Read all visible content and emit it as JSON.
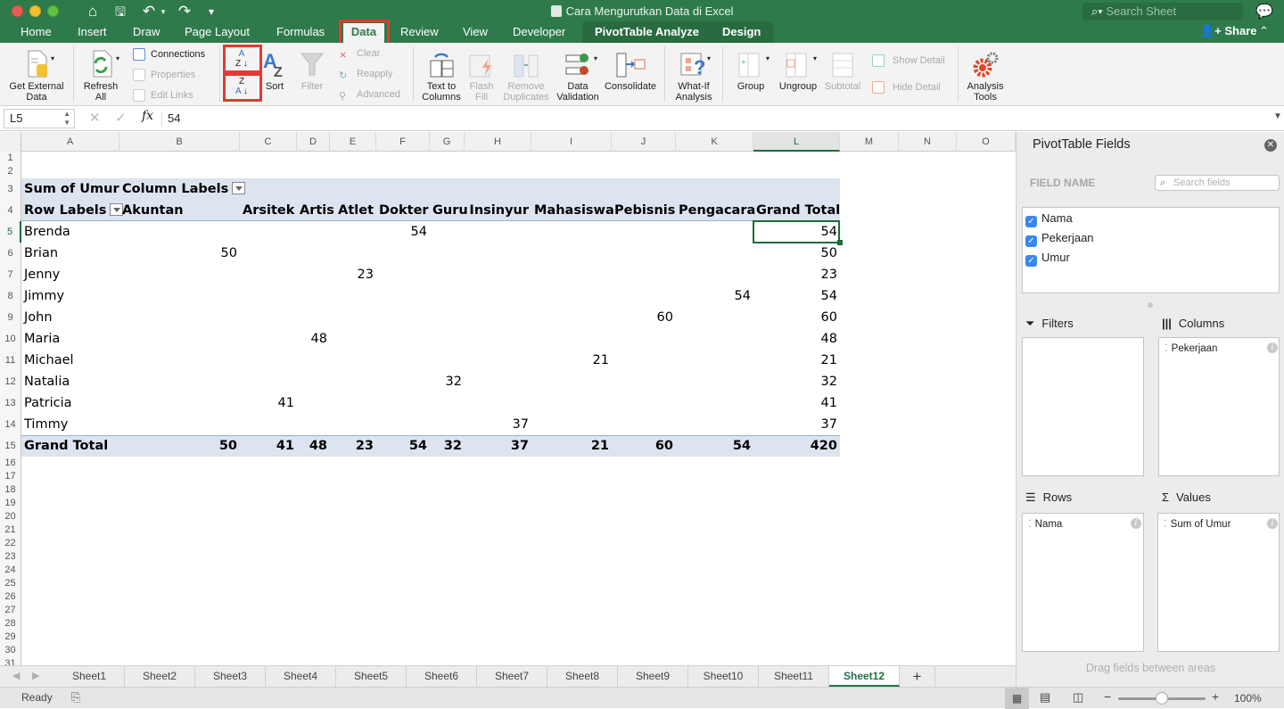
{
  "window": {
    "title": "Cara Mengurutkan Data di Excel",
    "search_placeholder": "Search Sheet",
    "share_label": "Share",
    "accent_color": "#2f7a4b"
  },
  "qat": {
    "home": "⌂",
    "save": "🖫",
    "undo": "↶",
    "redo": "↷",
    "customize": "▾"
  },
  "tabs": [
    "Home",
    "Insert",
    "Draw",
    "Page Layout",
    "Formulas",
    "Data",
    "Review",
    "View",
    "Developer",
    "PivotTable Analyze",
    "Design"
  ],
  "active_tab": "Data",
  "ribbon": {
    "get_external_data": "Get External Data",
    "refresh_all": "Refresh All",
    "connections": "Connections",
    "properties": "Properties",
    "edit_links": "Edit Links",
    "sort_az": "A→Z",
    "sort_za": "Z→A",
    "sort": "Sort",
    "filter": "Filter",
    "clear": "Clear",
    "reapply": "Reapply",
    "advanced": "Advanced",
    "text_to_columns": "Text to Columns",
    "flash_fill": "Flash Fill",
    "remove_duplicates": "Remove Duplicates",
    "data_validation": "Data Validation",
    "consolidate": "Consolidate",
    "what_if": "What-If Analysis",
    "group": "Group",
    "ungroup": "Ungroup",
    "subtotal": "Subtotal",
    "show_detail": "Show Detail",
    "hide_detail": "Hide Detail",
    "analysis_tools": "Analysis Tools"
  },
  "formula_bar": {
    "name_box": "L5",
    "value": "54",
    "fx": "fx"
  },
  "columns": [
    "A",
    "B",
    "C",
    "D",
    "E",
    "F",
    "G",
    "H",
    "I",
    "J",
    "K",
    "L",
    "M",
    "N",
    "O"
  ],
  "selected_column": "L",
  "selected_row": 5,
  "row_numbers": [
    1,
    2,
    3,
    4,
    5,
    6,
    7,
    8,
    9,
    10,
    11,
    12,
    13,
    14,
    15,
    16,
    17,
    18,
    19,
    20,
    21,
    22,
    23,
    24,
    25,
    26,
    27,
    28,
    29,
    30,
    31
  ],
  "pivot": {
    "value_label": "Sum of Umur",
    "column_labels": "Column Labels",
    "row_labels": "Row Labels",
    "headers": [
      "Akuntan",
      "Arsitek",
      "Artis",
      "Atlet",
      "Dokter",
      "Guru",
      "Insinyur",
      "Mahasiswa",
      "Pebisnis",
      "Pengacara",
      "Grand Total"
    ],
    "rows": [
      {
        "name": "Brenda",
        "values": [
          "",
          "",
          "",
          "",
          "54",
          "",
          "",
          "",
          "",
          "",
          "54"
        ]
      },
      {
        "name": "Brian",
        "values": [
          "50",
          "",
          "",
          "",
          "",
          "",
          "",
          "",
          "",
          "",
          "50"
        ]
      },
      {
        "name": "Jenny",
        "values": [
          "",
          "",
          "",
          "23",
          "",
          "",
          "",
          "",
          "",
          "",
          "23"
        ]
      },
      {
        "name": "Jimmy",
        "values": [
          "",
          "",
          "",
          "",
          "",
          "",
          "",
          "",
          "",
          "54",
          "54"
        ]
      },
      {
        "name": "John",
        "values": [
          "",
          "",
          "",
          "",
          "",
          "",
          "",
          "",
          "60",
          "",
          "60"
        ]
      },
      {
        "name": "Maria",
        "values": [
          "",
          "",
          "48",
          "",
          "",
          "",
          "",
          "",
          "",
          "",
          "48"
        ]
      },
      {
        "name": "Michael",
        "values": [
          "",
          "",
          "",
          "",
          "",
          "",
          "",
          "21",
          "",
          "",
          "21"
        ]
      },
      {
        "name": "Natalia",
        "values": [
          "",
          "",
          "",
          "",
          "",
          "32",
          "",
          "",
          "",
          "",
          "32"
        ]
      },
      {
        "name": "Patricia",
        "values": [
          "",
          "41",
          "",
          "",
          "",
          "",
          "",
          "",
          "",
          "",
          "41"
        ]
      },
      {
        "name": "Timmy",
        "values": [
          "",
          "",
          "",
          "",
          "",
          "",
          "37",
          "",
          "",
          "",
          "37"
        ]
      }
    ],
    "grand_total": {
      "label": "Grand Total",
      "values": [
        "50",
        "41",
        "48",
        "23",
        "54",
        "32",
        "37",
        "21",
        "60",
        "54",
        "420"
      ]
    }
  },
  "sheets": [
    "Sheet1",
    "Sheet2",
    "Sheet3",
    "Sheet4",
    "Sheet5",
    "Sheet6",
    "Sheet7",
    "Sheet8",
    "Sheet9",
    "Sheet10",
    "Sheet11",
    "Sheet12"
  ],
  "active_sheet": "Sheet12",
  "add_sheet": "+",
  "status": {
    "ready": "Ready",
    "zoom": "100%",
    "zoom_fraction": 0.5
  },
  "pivot_panel": {
    "title": "PivotTable Fields",
    "field_name_label": "FIELD NAME",
    "search_placeholder": "Search fields",
    "fields": [
      {
        "name": "Nama",
        "checked": true
      },
      {
        "name": "Pekerjaan",
        "checked": true
      },
      {
        "name": "Umur",
        "checked": true
      }
    ],
    "filters_label": "Filters",
    "columns_label": "Columns",
    "rows_label": "Rows",
    "values_label": "Values",
    "columns_item": "Pekerjaan",
    "rows_item": "Nama",
    "values_item": "Sum of Umur",
    "hint": "Drag fields between areas"
  }
}
